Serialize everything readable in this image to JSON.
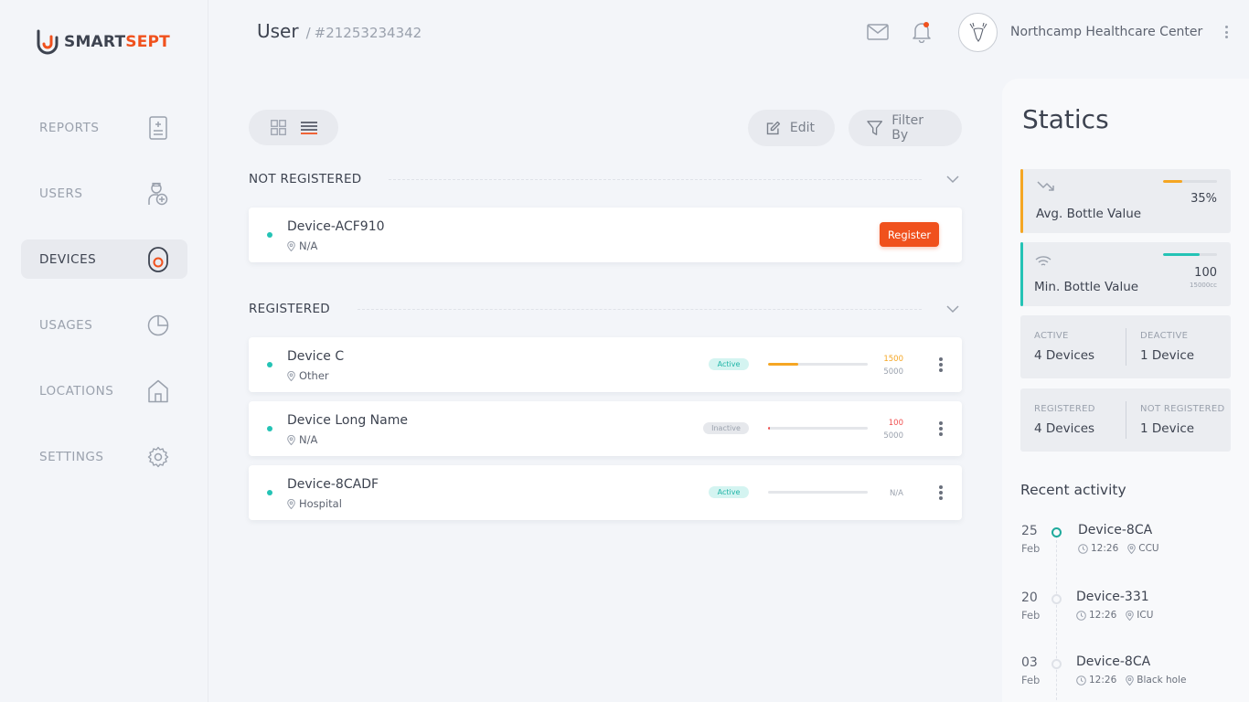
{
  "brand": {
    "part1": "SMART",
    "part2": "SEPT",
    "accent": "#f0511d"
  },
  "nav": {
    "items": [
      {
        "label": "REPORTS",
        "icon": "report-icon"
      },
      {
        "label": "USERS",
        "icon": "user-add-icon"
      },
      {
        "label": "DEVICES",
        "icon": "device-icon",
        "active": true
      },
      {
        "label": "USAGES",
        "icon": "pie-chart-icon"
      },
      {
        "label": "LOCATIONS",
        "icon": "home-icon"
      },
      {
        "label": "SETTINGS",
        "icon": "gear-icon"
      }
    ]
  },
  "header": {
    "title": "User",
    "separator": "/",
    "id": "#21253234342",
    "org_name": "Northcamp Healthcare Center"
  },
  "toolbar": {
    "edit_label": "Edit",
    "filter_label": "Filter By"
  },
  "sections": {
    "not_registered": {
      "label": "NOT REGISTERED",
      "devices": [
        {
          "name": "Device-ACF910",
          "location": "N/A",
          "action": "Register"
        }
      ]
    },
    "registered": {
      "label": "REGISTERED",
      "devices": [
        {
          "name": "Device C",
          "location": "Other",
          "status": "Active",
          "value": "1500",
          "max": "5000",
          "progress": 0.3,
          "color": "#f5a623"
        },
        {
          "name": "Device Long Name",
          "location": "N/A",
          "status": "Inactive",
          "value": "100",
          "max": "5000",
          "progress": 0.02,
          "color": "#f04f4f"
        },
        {
          "name": "Device-8CADF",
          "location": "Hospital",
          "status": "Active",
          "value": "N/A",
          "max": "",
          "progress": 0,
          "color": "#9aa1ad"
        }
      ]
    }
  },
  "statics": {
    "title": "Statics",
    "avg": {
      "label": "Avg. Bottle Value",
      "value": "35%",
      "progress": 0.35,
      "color": "#f5a623"
    },
    "min": {
      "label": "Min. Bottle Value",
      "value": "100",
      "sub": "15000cc",
      "progress": 0.68,
      "color": "#24c3b5"
    },
    "active": {
      "label": "ACTIVE",
      "value": "4 Devices"
    },
    "deactive": {
      "label": "DEACTIVE",
      "value": "1 Device"
    },
    "registered": {
      "label": "REGISTERED",
      "value": "4 Devices"
    },
    "not_registered": {
      "label": "NOT REGISTERED",
      "value": "1 Device"
    }
  },
  "recent_activity": {
    "title": "Recent activity",
    "items": [
      {
        "day": "25",
        "month": "Feb",
        "name": "Device-8CA",
        "time": "12:26",
        "location": "CCU",
        "current": true
      },
      {
        "day": "20",
        "month": "Feb",
        "name": "Device-331",
        "time": "12:26",
        "location": "ICU",
        "current": false
      },
      {
        "day": "03",
        "month": "Feb",
        "name": "Device-8CA",
        "time": "12:26",
        "location": "Black hole",
        "current": false
      }
    ]
  }
}
